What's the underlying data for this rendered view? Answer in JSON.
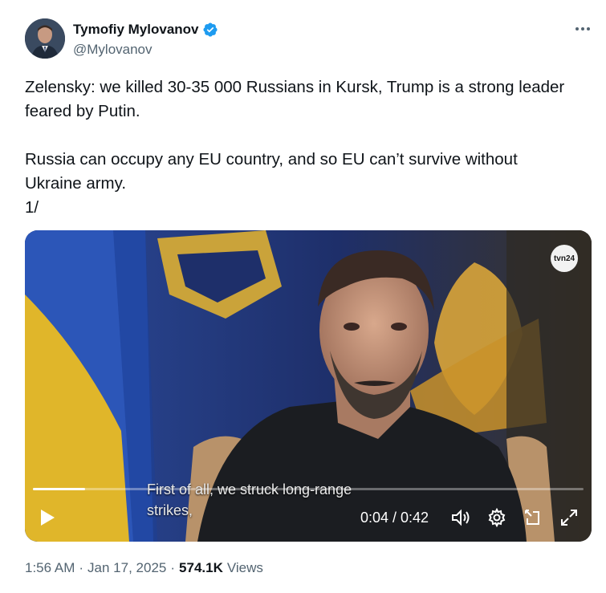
{
  "author": {
    "name": "Tymofiy Mylovanov",
    "handle": "@Mylovanov",
    "verified": true
  },
  "tweet": {
    "lines": [
      "Zelensky: we killed 30-35 000 Russians in Kursk, Trump is a strong leader feared by Putin.",
      "Russia can occupy any EU country, and so EU can’t survive without Ukraine army.",
      "1/"
    ]
  },
  "video": {
    "subtitle_line1": "First of all, we struck long-range",
    "subtitle_line2": "strikes,",
    "time_display": "0:04 / 0:42",
    "progress_fraction": 0.095,
    "channel_logo": "tvn24"
  },
  "meta": {
    "time": "1:56 AM",
    "separator": "·",
    "date": "Jan 17, 2025",
    "views_count": "574.1K",
    "views_label": "Views"
  },
  "colors": {
    "accent_verified": "#1d9bf0",
    "text_primary": "#0f1419",
    "text_secondary": "#536471"
  },
  "icons": [
    "more-icon",
    "verified-badge-icon",
    "play-icon",
    "volume-icon",
    "settings-gear-icon",
    "pip-icon",
    "fullscreen-icon"
  ]
}
